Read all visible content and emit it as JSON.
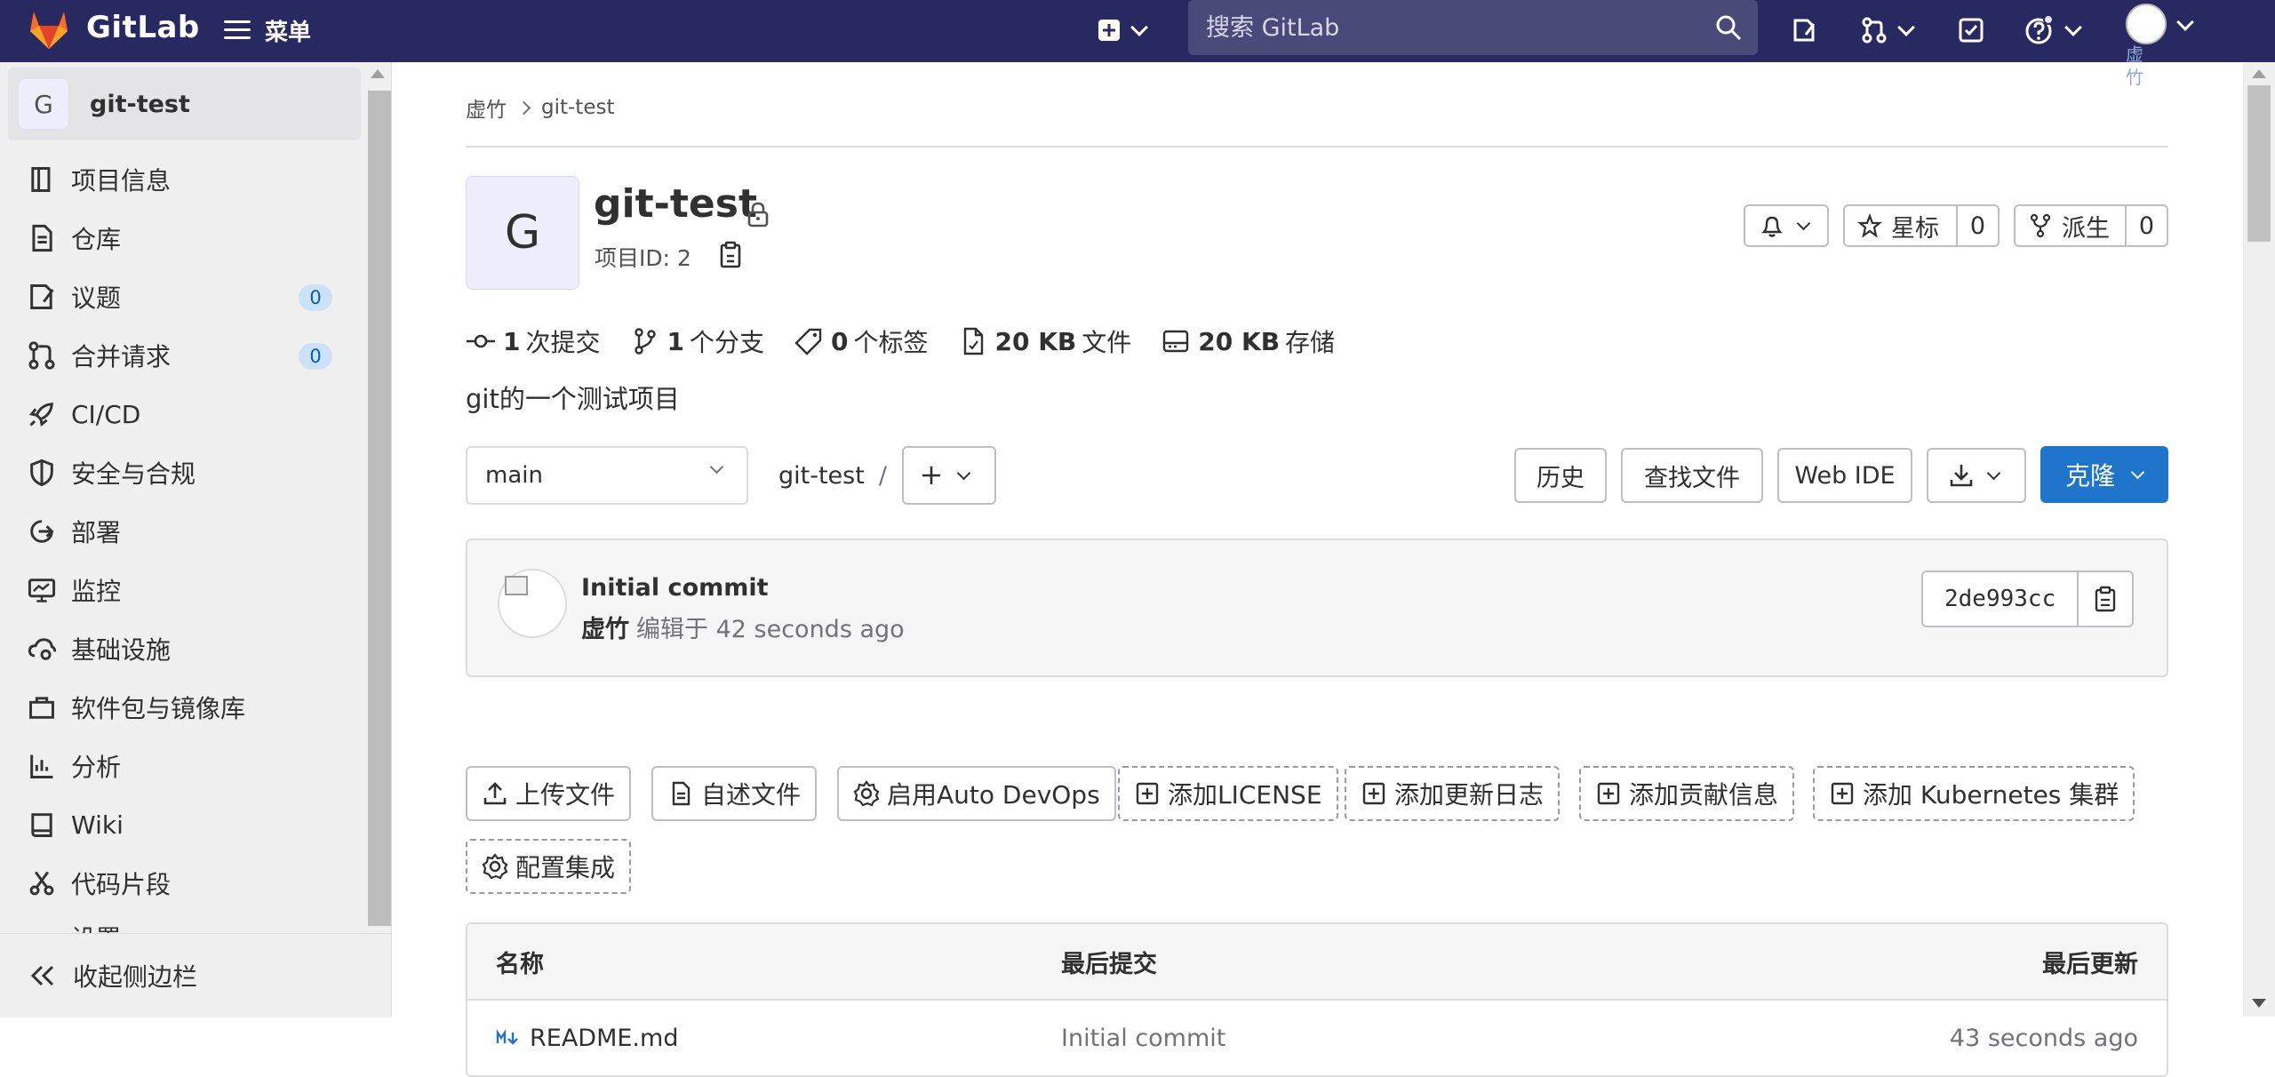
{
  "topbar": {
    "brand": "GitLab",
    "menu_label": "菜单",
    "search_placeholder": "搜索 GitLab",
    "user_label": "虚竹",
    "colors": {
      "bg": "#292961",
      "logo_orange": "#e24329"
    }
  },
  "sidebar": {
    "project_avatar": "G",
    "project_name": "git-test",
    "items": [
      {
        "label": "项目信息",
        "icon": "project-info-icon"
      },
      {
        "label": "仓库",
        "icon": "repository-icon"
      },
      {
        "label": "议题",
        "icon": "issues-icon",
        "count": "0"
      },
      {
        "label": "合并请求",
        "icon": "merge-request-icon",
        "count": "0"
      },
      {
        "label": "CI/CD",
        "icon": "rocket-icon"
      },
      {
        "label": "安全与合规",
        "icon": "shield-icon"
      },
      {
        "label": "部署",
        "icon": "deployments-icon"
      },
      {
        "label": "监控",
        "icon": "monitor-icon"
      },
      {
        "label": "基础设施",
        "icon": "cloud-gear-icon"
      },
      {
        "label": "软件包与镜像库",
        "icon": "package-icon"
      },
      {
        "label": "分析",
        "icon": "chart-icon"
      },
      {
        "label": "Wiki",
        "icon": "book-icon"
      },
      {
        "label": "代码片段",
        "icon": "snippet-icon"
      }
    ],
    "partial_item": "设置",
    "collapse_label": "收起侧边栏"
  },
  "breadcrumb": {
    "parent": "虚竹",
    "current": "git-test"
  },
  "project": {
    "avatar_letter": "G",
    "title": "git-test",
    "id_label": "项目ID: 2",
    "star_label": "星标",
    "star_count": "0",
    "fork_label": "派生",
    "fork_count": "0",
    "description": "git的一个测试项目"
  },
  "stats": [
    {
      "value": "1",
      "label": "次提交",
      "icon": "commit-icon"
    },
    {
      "value": "1",
      "label": "个分支",
      "icon": "branch-icon"
    },
    {
      "value": "0",
      "label": "个标签",
      "icon": "tag-icon"
    },
    {
      "value": "20 KB",
      "label": "文件",
      "icon": "file-icon"
    },
    {
      "value": "20 KB",
      "label": "存储",
      "icon": "storage-icon"
    }
  ],
  "repo": {
    "branch": "main",
    "path": "git-test",
    "path_sep": "/",
    "history": "历史",
    "find_file": "查找文件",
    "web_ide": "Web IDE",
    "clone": "克隆"
  },
  "commit": {
    "title": "Initial commit",
    "author": "虚竹",
    "meta": "编辑于 42 seconds ago",
    "sha": "2de993cc"
  },
  "actions": [
    {
      "label": "上传文件",
      "icon": "upload-icon",
      "style": "solid"
    },
    {
      "label": "自述文件",
      "icon": "document-icon",
      "style": "solid"
    },
    {
      "label": "启用Auto DevOps",
      "icon": "gear-icon",
      "style": "solid"
    },
    {
      "label": "添加LICENSE",
      "icon": "plus-square-icon",
      "style": "dashed"
    },
    {
      "label": "添加更新日志",
      "icon": "plus-square-icon",
      "style": "dashed"
    },
    {
      "label": "添加贡献信息",
      "icon": "plus-square-icon",
      "style": "dashed"
    },
    {
      "label": "添加 Kubernetes 集群",
      "icon": "plus-square-icon",
      "style": "dashed"
    },
    {
      "label": "配置集成",
      "icon": "gear-icon",
      "style": "dashed"
    }
  ],
  "files": {
    "headers": {
      "name": "名称",
      "last_commit": "最后提交",
      "last_update": "最后更新"
    },
    "rows": [
      {
        "name": "README.md",
        "icon": "markdown-icon",
        "commit": "Initial commit",
        "updated": "43 seconds ago"
      }
    ]
  }
}
